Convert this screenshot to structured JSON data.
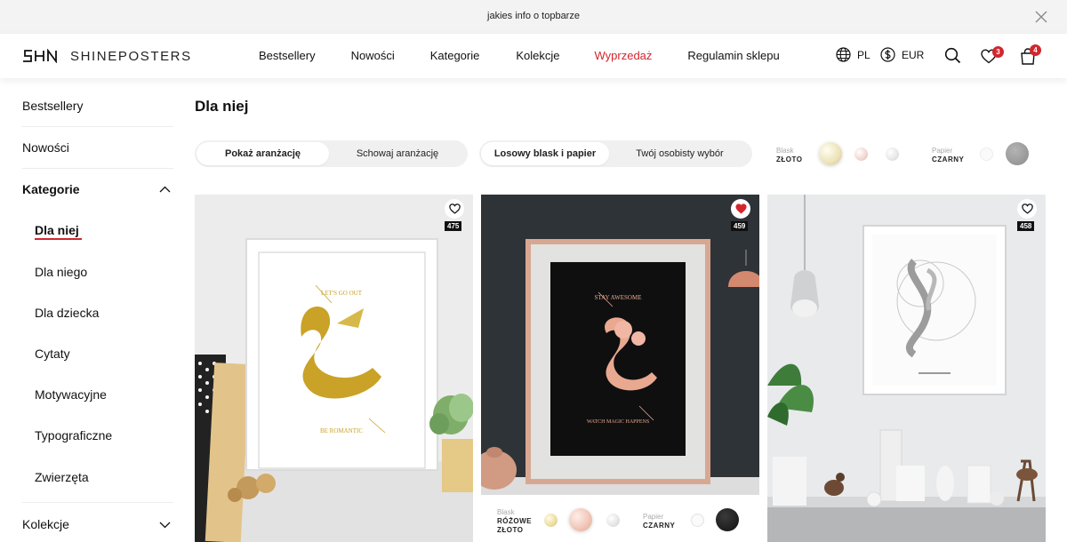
{
  "topbar": {
    "message": "jakies info o topbarze"
  },
  "brand": {
    "name": "SHINEPOSTERS"
  },
  "nav": [
    {
      "label": "Bestsellery"
    },
    {
      "label": "Nowości"
    },
    {
      "label": "Kategorie"
    },
    {
      "label": "Kolekcje"
    },
    {
      "label": "Wyprzedaż"
    },
    {
      "label": "Regulamin sklepu"
    }
  ],
  "header": {
    "language": "PL",
    "currency": "EUR",
    "wishlist_count": "3",
    "cart_count": "4"
  },
  "sidebar": {
    "bestsellery": "Bestsellery",
    "nowosci": "Nowości",
    "kategorie": "Kategorie",
    "kolekcje": "Kolekcje",
    "sub": [
      {
        "label": "Dla niej"
      },
      {
        "label": "Dla niego"
      },
      {
        "label": "Dla dziecka"
      },
      {
        "label": "Cytaty"
      },
      {
        "label": "Motywacyjne"
      },
      {
        "label": "Typograficzne"
      },
      {
        "label": "Zwierzęta"
      }
    ]
  },
  "page": {
    "title": "Dla niej"
  },
  "filters": {
    "arrangement": {
      "show": "Pokaż aranżację",
      "hide": "Schowaj aranżację"
    },
    "mode": {
      "random": "Losowy blask i papier",
      "custom": "Twój osobisty wybór"
    },
    "blask": {
      "label": "Blask",
      "value": "ZŁOTO"
    },
    "papier": {
      "label": "Papier",
      "value": "CZARNY"
    }
  },
  "products": [
    {
      "count": "475",
      "favorited": false,
      "quote_top": "LET'S GO OUT",
      "quote_bottom": "BE ROMANTIC"
    },
    {
      "count": "459",
      "favorited": true,
      "quote_top": "STAY AWESOME",
      "quote_bottom": "WATCH MAGIC HAPPENS",
      "blask_label": "Blask",
      "blask_line1": "RÓŻOWE",
      "blask_line2": "ZŁOTO",
      "papier_label": "Papier",
      "papier_value": "CZARNY"
    },
    {
      "count": "458",
      "favorited": false
    }
  ],
  "colors": {
    "accent": "#d2262f",
    "gold": "#c9a227",
    "rose_gold": "#e8a990"
  }
}
